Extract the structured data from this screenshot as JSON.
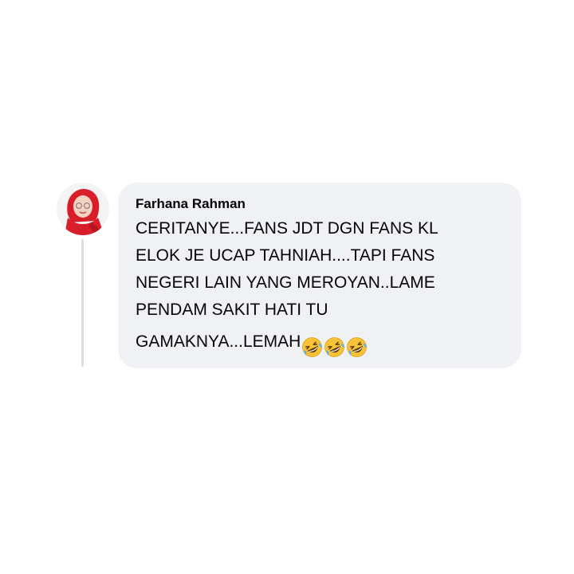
{
  "comment": {
    "author": "Farhana Rahman",
    "lines": [
      "CERITANYE...FANS JDT DGN FANS KL",
      "ELOK JE UCAP TAHNIAH....TAPI FANS",
      "NEGERI LAIN YANG MEROYAN..LAME",
      "PENDAM SAKIT HATI TU",
      "GAMAKNYA...LEMAH"
    ],
    "emojis": [
      "rolling-on-floor-laughing-emoji",
      "rolling-on-floor-laughing-emoji",
      "rolling-on-floor-laughing-emoji"
    ]
  },
  "colors": {
    "bubble_background": "#f0f1f4",
    "thread_line": "#dcdde1",
    "text": "#050505",
    "avatar_scarf": "#d81e2a",
    "emoji_face": "#f7c236"
  }
}
